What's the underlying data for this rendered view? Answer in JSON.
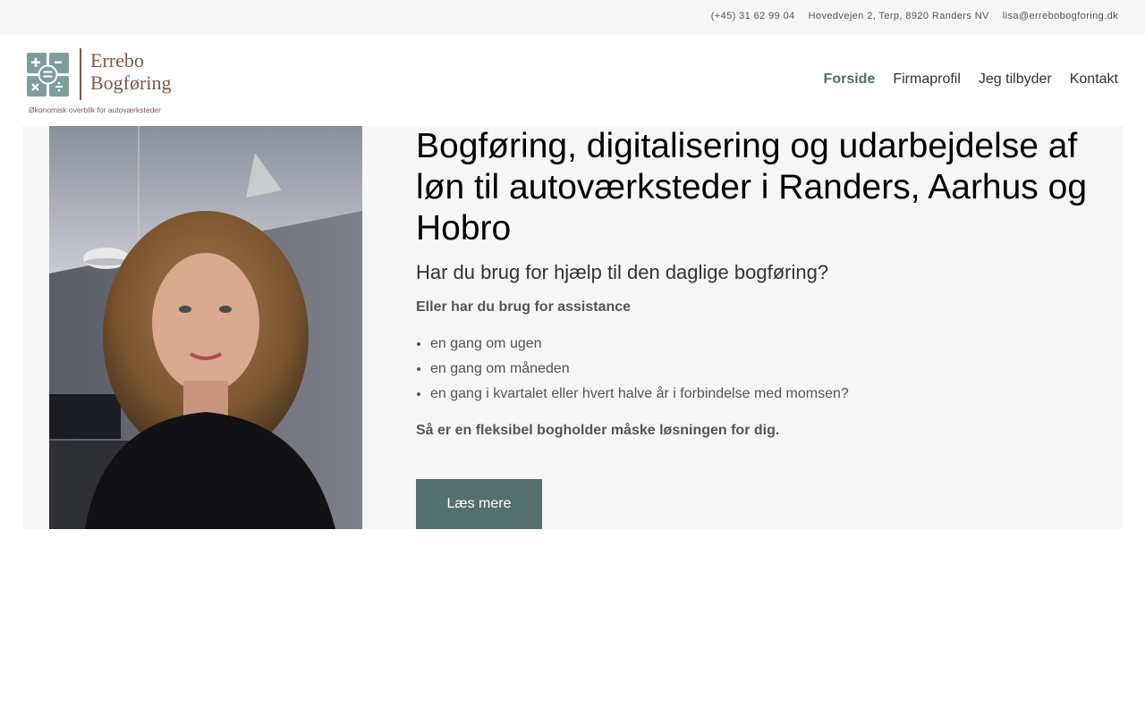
{
  "topbar": {
    "phone": "(+45) 31 62 99 04",
    "address": "Hovedvejen 2, Terp, 8920 Randers NV",
    "email": "lisa@errebobogforing.dk"
  },
  "logo": {
    "line1": "Errebo",
    "line2": "Bogføring",
    "tagline": "Økonomisk overblik for autoværksteder"
  },
  "nav": {
    "items": [
      {
        "label": "Forside",
        "active": true
      },
      {
        "label": "Firmaprofil",
        "active": false
      },
      {
        "label": "Jeg tilbyder",
        "active": false
      },
      {
        "label": "Kontakt",
        "active": false
      }
    ]
  },
  "hero": {
    "title": "Bogføring, digitalisering og udarbejdelse af løn til autoværksteder i Randers, Aarhus og Hobro",
    "subtitle": "Har du brug for hjælp til den daglige bogføring?",
    "intro": "Eller har du brug for assistance",
    "list": [
      "en gang om ugen",
      "en gang om måneden",
      "en gang i kvartalet eller hvert halve år i forbindelse med momsen?"
    ],
    "closing": "Så er en fleksibel bogholder måske løsningen for dig.",
    "cta_label": "Læs mere"
  },
  "colors": {
    "accent": "#54706c",
    "brand_brown": "#7a5a4a",
    "panel_bg": "#f6f6f6"
  }
}
